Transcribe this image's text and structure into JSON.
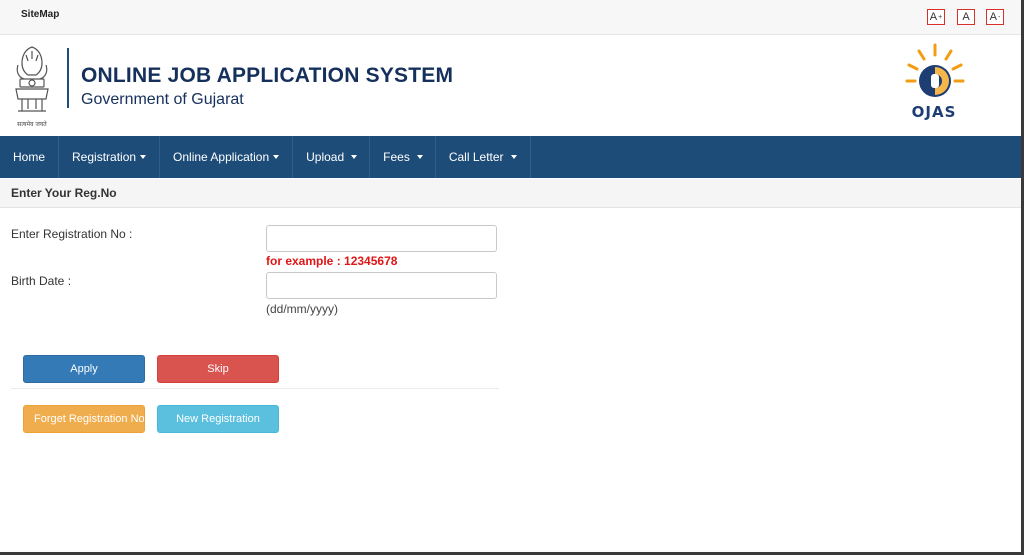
{
  "topbar": {
    "sitemap_label": "SiteMap",
    "font_controls": [
      {
        "label": "A",
        "suffix": "+"
      },
      {
        "label": "A",
        "suffix": ""
      },
      {
        "label": "A",
        "suffix": "-"
      }
    ]
  },
  "header": {
    "title": "ONLINE JOB APPLICATION SYSTEM",
    "subtitle": "Government of Gujarat",
    "emblem_caption": "सत्यमेव जयते",
    "logo_text": "OJAS",
    "colors": {
      "brand_blue": "#16305c",
      "logo_orange": "#f39c12"
    }
  },
  "nav": {
    "items": [
      {
        "label": "Home",
        "dropdown": false
      },
      {
        "label": "Registration",
        "dropdown": true
      },
      {
        "label": "Online Application",
        "dropdown": true
      },
      {
        "label": "Upload",
        "dropdown": true
      },
      {
        "label": "Fees",
        "dropdown": true
      },
      {
        "label": "Call Letter",
        "dropdown": true
      }
    ],
    "color": "#1d4c79"
  },
  "form": {
    "heading": "Enter Your Reg.No",
    "reg_label": "Enter Registration No :",
    "reg_value": "",
    "reg_hint": "for example : 12345678",
    "birth_label": "Birth Date :",
    "birth_value": "",
    "birth_hint": "(dd/mm/yyyy)"
  },
  "buttons": {
    "apply": "Apply",
    "skip": "Skip",
    "forget": "Forget Registration No",
    "new_registration": "New Registration"
  }
}
